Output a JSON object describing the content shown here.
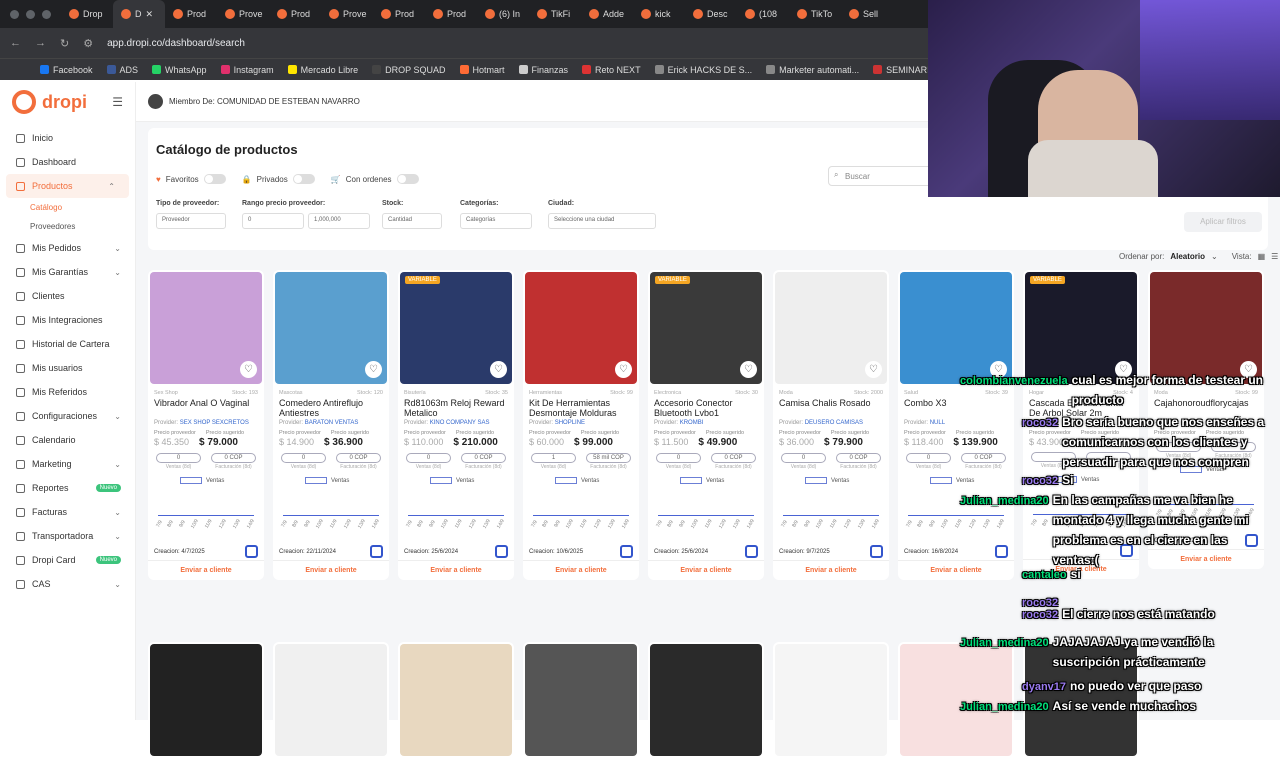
{
  "browser": {
    "tabs": [
      {
        "label": "Drop",
        "active": false
      },
      {
        "label": "D",
        "active": true
      },
      {
        "label": "Prod"
      },
      {
        "label": "Prove"
      },
      {
        "label": "Prod"
      },
      {
        "label": "Prove"
      },
      {
        "label": "Prod"
      },
      {
        "label": "Prod"
      },
      {
        "label": "(6) In"
      },
      {
        "label": "TikFi"
      },
      {
        "label": "Adde"
      },
      {
        "label": "kick"
      },
      {
        "label": "Desc"
      },
      {
        "label": "(108"
      },
      {
        "label": "TikTo"
      },
      {
        "label": "Sell"
      }
    ],
    "url": "app.dropi.co/dashboard/search",
    "bookmarks": [
      "Facebook",
      "ADS",
      "WhatsApp",
      "Instagram",
      "Mercado Libre",
      "DROP SQUAD",
      "Hotmart",
      "Finanzas",
      "Reto NEXT",
      "Erick HACKS DE S...",
      "Marketer automati...",
      "SEMINARIOS"
    ]
  },
  "sidebar": {
    "logo": "dropi",
    "items": [
      {
        "label": "Inicio"
      },
      {
        "label": "Dashboard"
      },
      {
        "label": "Productos",
        "active": true,
        "chevron": "⌃"
      },
      {
        "label": "Mis Pedidos",
        "chevron": "⌄"
      },
      {
        "label": "Mis Garantías",
        "chevron": "⌄"
      },
      {
        "label": "Clientes"
      },
      {
        "label": "Mis Integraciones"
      },
      {
        "label": "Historial de Cartera"
      },
      {
        "label": "Mis usuarios"
      },
      {
        "label": "Mis Referidos"
      },
      {
        "label": "Configuraciones",
        "chevron": "⌄"
      },
      {
        "label": "Calendario"
      },
      {
        "label": "Marketing",
        "chevron": "⌄"
      },
      {
        "label": "Reportes",
        "badge": "Nuevo"
      },
      {
        "label": "Facturas",
        "chevron": "⌄"
      },
      {
        "label": "Transportadora",
        "chevron": "⌄"
      },
      {
        "label": "Dropi Card",
        "badge": "Nuevo"
      },
      {
        "label": "CAS",
        "chevron": "⌄"
      }
    ],
    "subitems": [
      "Catálogo",
      "Proveedores"
    ]
  },
  "topbar": {
    "member": "Miembro De: COMUNIDAD DE ESTEBAN NAVARRO"
  },
  "catalog": {
    "title": "Catálogo de productos",
    "toggles": [
      "Favoritos",
      "Privados",
      "Con ordenes"
    ],
    "search_placeholder": "Buscar",
    "filters": [
      {
        "label": "Tipo de proveedor:",
        "value": "Proveedor"
      },
      {
        "label": "Rango precio proveedor:",
        "min": "0",
        "max": "1,000,000"
      },
      {
        "label": "Stock:",
        "value": "Cantidad"
      },
      {
        "label": "Categorías:",
        "value": "Categorías"
      },
      {
        "label": "Ciudad:",
        "value": "Seleccione una ciudad"
      }
    ],
    "apply": "Aplicar filtros",
    "order_label": "Ordenar por:",
    "order_value": "Aleatorio",
    "view_label": "Vista:"
  },
  "product_labels": {
    "provider_price": "Precio proveedor",
    "suggested_price": "Precio sugerido",
    "sales": "Ventas (8d)",
    "billing": "Facturación (8d)",
    "chart_legend": "Ventas",
    "send": "Enviar a cliente",
    "provider": "Provider:"
  },
  "products": [
    {
      "category": "Sex Shop",
      "stock": "Stock: 193",
      "name": "Vibrador Anal O Vaginal",
      "provider": "SEX SHOP SEXCRETOS",
      "price_provider": "$ 45.350",
      "price_suggested": "$ 79.000",
      "sales": "0",
      "billing": "0 COP",
      "created": "Creacion: 4/7/2025",
      "color": "#c9a0d8",
      "variable": false
    },
    {
      "category": "Mascotas",
      "stock": "Stock: 120",
      "name": "Comedero Antireflujo Antiestres",
      "provider": "BARATON VENTAS",
      "price_provider": "$ 14.900",
      "price_suggested": "$ 36.900",
      "sales": "0",
      "billing": "0 COP",
      "created": "Creacion: 22/11/2024",
      "color": "#5a9fcf",
      "variable": false
    },
    {
      "category": "Bisutería",
      "stock": "Stock: 35",
      "name": "Rd81063m Reloj Reward Metalico",
      "provider": "KINO COMPANY SAS",
      "price_provider": "$ 110.000",
      "price_suggested": "$ 210.000",
      "sales": "0",
      "billing": "0 COP",
      "created": "Creacion: 25/6/2024",
      "color": "#2a3a6a",
      "variable": true
    },
    {
      "category": "Herramientas",
      "stock": "Stock: 99",
      "name": "Kit De Herramientas Desmontaje Molduras",
      "provider": "SHOPLINE",
      "price_provider": "$ 60.000",
      "price_suggested": "$ 99.000",
      "sales": "1",
      "billing": "58 mil COP",
      "created": "Creacion: 10/6/2025",
      "color": "#c03030",
      "variable": false
    },
    {
      "category": "Electronica",
      "stock": "Stock: 30",
      "name": "Accesorio Conector Bluetooth Lvbo1",
      "provider": "KROMBI",
      "price_provider": "$ 11.500",
      "price_suggested": "$ 49.900",
      "sales": "0",
      "billing": "0 COP",
      "created": "Creacion: 25/6/2024",
      "color": "#3a3a3a",
      "variable": true
    },
    {
      "category": "Moda",
      "stock": "Stock: 2000",
      "name": "Camisa Chalis Rosado",
      "provider": "DEUSERO CAMISAS",
      "price_provider": "$ 36.000",
      "price_suggested": "$ 79.900",
      "sales": "0",
      "billing": "0 COP",
      "created": "Creacion: 9/7/2025",
      "color": "#eeeeee",
      "variable": false
    },
    {
      "category": "Salud",
      "stock": "Stock: 39",
      "name": "Combo X3",
      "provider": "NULL",
      "price_provider": "$ 118.400",
      "price_suggested": "$ 139.900",
      "sales": "0",
      "billing": "0 COP",
      "created": "Creacion: 16/8/2024",
      "color": "#3a8fd0",
      "variable": false
    },
    {
      "category": "Hogar",
      "stock": "Stock: 4",
      "name": "Cascada Estrella Punta De Arbol Solar 2m",
      "provider": "",
      "price_provider": "$ 43.900",
      "price_suggested": "",
      "sales": "",
      "billing": "",
      "created": "",
      "color": "#1a1a2a",
      "variable": true
    },
    {
      "category": "Moda",
      "stock": "Stock: 99",
      "name": "Cajahonoroudflorycajas",
      "provider": "",
      "price_provider": "",
      "price_suggested": "",
      "sales": "",
      "billing": "",
      "created": "Creacion: 7/1/2025",
      "color": "#7a2a2a",
      "variable": false
    }
  ],
  "chart_x_labels": [
    "7/9",
    "8/9",
    "9/9",
    "10/9",
    "11/9",
    "12/9",
    "13/9",
    "14/9"
  ],
  "chat": [
    {
      "user": "colombianvenezuela",
      "color": "#00e07a",
      "msg": "cual es mejor forma de testear un producto"
    },
    {
      "user": "roco32",
      "color": "#9a7af0",
      "msg": "Bro sería bueno que nos enseñes a comunicarnos con los clientes y persuadir para que nos compren"
    },
    {
      "user": "roco32",
      "color": "#9a7af0",
      "msg": "Si"
    },
    {
      "user": "Julian_medina20",
      "color": "#00e07a",
      "msg": "En las campañas me va bien he montado 4 y llega mucha gente mi problema es en el cierre en las ventas:("
    },
    {
      "user": "cantaleo",
      "color": "#00e07a",
      "msg": "si"
    },
    {
      "user": "roco32",
      "color": "#9a7af0",
      "msg": ""
    },
    {
      "user": "roco32",
      "color": "#9a7af0",
      "msg": "El cierre nos está matando"
    },
    {
      "user": "Julian_medina20",
      "color": "#00e07a",
      "msg": "JAJAJAJAJ ya me vendió la suscripción prácticamente"
    },
    {
      "user": "dyanv17",
      "color": "#9a7af0",
      "msg": "no puedo ver que paso"
    },
    {
      "user": "Julian_medina20",
      "color": "#00e07a",
      "msg": "Así se vende muchachos"
    }
  ]
}
